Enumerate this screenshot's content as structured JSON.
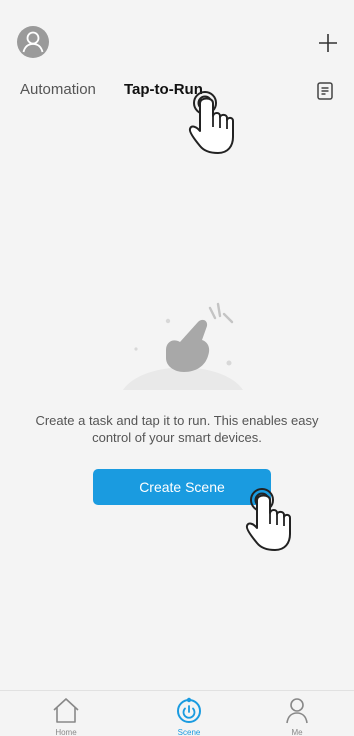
{
  "header": {
    "avatar_icon": "user-avatar-icon",
    "add_icon": "plus-icon"
  },
  "tabs": [
    {
      "label": "Automation",
      "selected": false
    },
    {
      "label": "Tap-to-Run",
      "selected": true
    }
  ],
  "log_icon": "document-log-icon",
  "empty_state": {
    "illustration": "hand-tap-illustration",
    "message": "Create a task and tap it to run. This enables easy control of your smart devices.",
    "button_label": "Create Scene"
  },
  "bottom_nav": [
    {
      "label": "Home",
      "icon": "home-icon",
      "active": false
    },
    {
      "label": "Scene",
      "icon": "scene-power-icon",
      "active": true
    },
    {
      "label": "Me",
      "icon": "person-icon",
      "active": false
    }
  ],
  "colors": {
    "accent": "#1a9be0",
    "background": "#f4f4f4",
    "muted_text": "#555555",
    "avatar": "#9a9a9a"
  }
}
